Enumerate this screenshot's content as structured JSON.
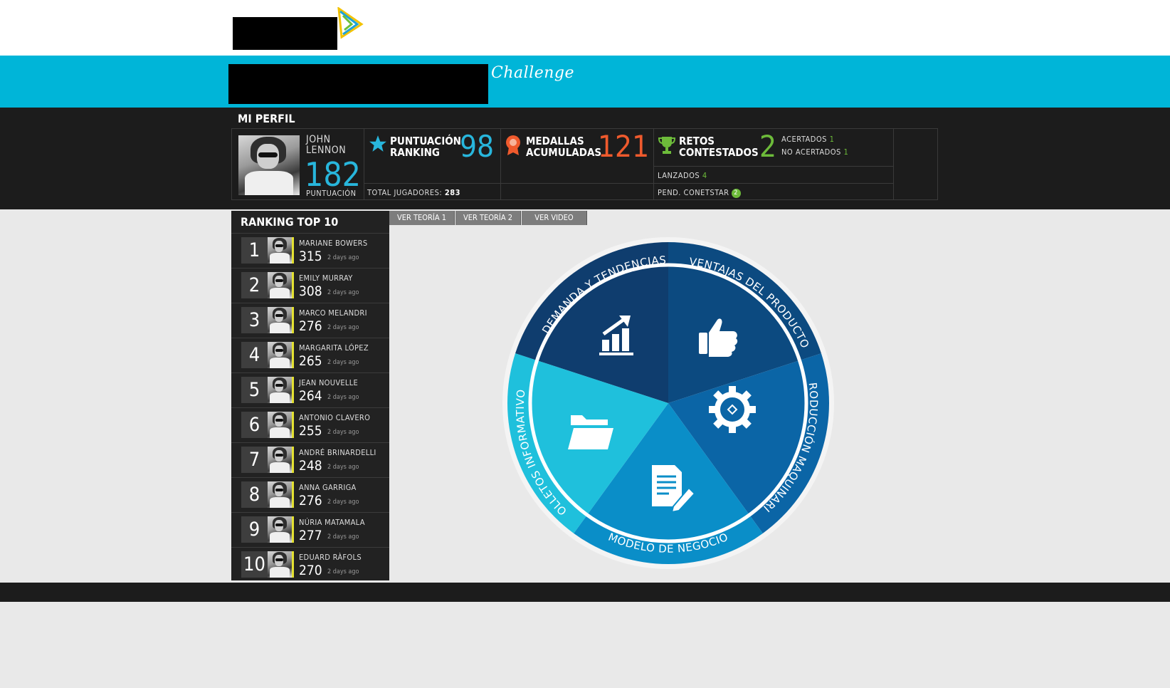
{
  "header": {
    "challenge": "Challenge"
  },
  "perfil": {
    "title": "MI PERFIL",
    "first_name": "JOHN",
    "last_name": "LENNON",
    "score": "182",
    "score_label": "PUNTUACIÓN",
    "puntuacion_label_1": "PUNTUACIÓN",
    "puntuacion_label_2": "RANKING",
    "ranking_value": "98",
    "total_jugadores_label": "TOTAL JUGADORES:",
    "total_jugadores": "283",
    "medallas_label_1": "MEDALLAS",
    "medallas_label_2": "ACUMULADAS",
    "medallas_value": "121",
    "retos_label_1": "RETOS",
    "retos_label_2": "CONTESTADOS",
    "retos_value": "2",
    "acertados_label": "ACERTADOS",
    "acertados_value": "1",
    "no_acertados_label": "NO ACERTADOS",
    "no_acertados_value": "1",
    "lanzados_label": "LANZADOS",
    "lanzados_value": "4",
    "pend_label": "PEND. CONETSTAR",
    "pend_value": "2"
  },
  "ranking": {
    "title": "RANKING TOP 10",
    "rows": [
      {
        "pos": "1",
        "name": "MARIANE BOWERS",
        "score": "315",
        "ago": "2 days ago"
      },
      {
        "pos": "2",
        "name": "EMILY MURRAY",
        "score": "308",
        "ago": "2 days ago"
      },
      {
        "pos": "3",
        "name": "MARCO MELANDRI",
        "score": "276",
        "ago": "2 days ago"
      },
      {
        "pos": "4",
        "name": "MARGARITA LÓPEZ",
        "score": "265",
        "ago": "2 days ago"
      },
      {
        "pos": "5",
        "name": "JEAN NOUVELLE",
        "score": "264",
        "ago": "2 days ago"
      },
      {
        "pos": "6",
        "name": "ANTONIO CLAVERO",
        "score": "255",
        "ago": "2 days ago"
      },
      {
        "pos": "7",
        "name": "ANDRÉ BRINARDELLI",
        "score": "248",
        "ago": "2 days ago"
      },
      {
        "pos": "8",
        "name": "ANNA GARRIGA",
        "score": "276",
        "ago": "2 days ago"
      },
      {
        "pos": "9",
        "name": "NÚRIA MATAMALA",
        "score": "277",
        "ago": "2 days ago"
      },
      {
        "pos": "10",
        "name": "EDUARD RÀFOLS",
        "score": "270",
        "ago": "2 days ago"
      }
    ]
  },
  "tabs": [
    "VER TEORÍA 1",
    "VER TEORÍA 2",
    "VER VIDEO"
  ],
  "wheel": {
    "segments": [
      {
        "label": "DEMANDA Y TENDENCIAS",
        "icon": "chart-up-icon",
        "color": "#0f3d6e"
      },
      {
        "label": "VENTAJAS DEL PRODUCTO",
        "icon": "thumbs-up-icon",
        "color": "#0c4a80"
      },
      {
        "label": "PRODUCCIÓN MAQUINARIA",
        "icon": "gear-icon",
        "color": "#0b65a6"
      },
      {
        "label": "MODELO DE NEGOCIO",
        "icon": "document-edit-icon",
        "color": "#0a8ec8"
      },
      {
        "label": "FOLLETOS INFORMATIVOS",
        "icon": "folder-icon",
        "color": "#1fc0dc"
      }
    ]
  }
}
